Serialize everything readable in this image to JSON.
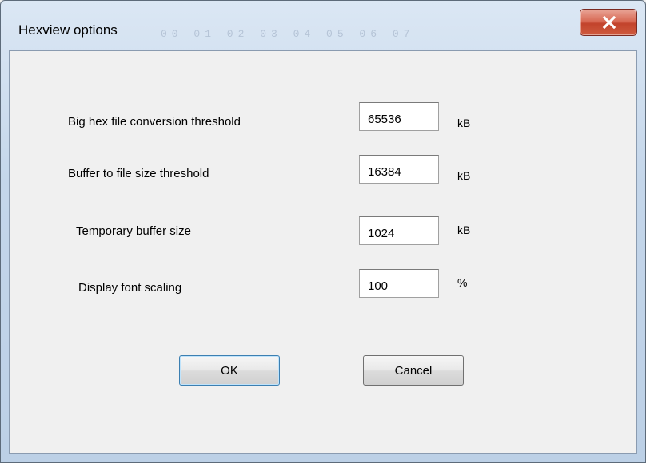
{
  "window": {
    "title": "Hexview options",
    "close_glyph": "x"
  },
  "background_ghost": "00 01 02 03   04 05 06 07",
  "fields": [
    {
      "label": "Big hex file conversion threshold",
      "value": "65536",
      "unit": "kB"
    },
    {
      "label": "Buffer to file size threshold",
      "value": "16384",
      "unit": "kB"
    },
    {
      "label": "Temporary buffer size",
      "value": "1024",
      "unit": "kB"
    },
    {
      "label": "Display font scaling",
      "value": "100",
      "unit": "%"
    }
  ],
  "buttons": {
    "ok_label": "OK",
    "cancel_label": "Cancel"
  },
  "colors": {
    "titlebar_glass": "#c4d6ea",
    "close_button": "#c2432c",
    "dialog_face": "#f0f0f0",
    "default_button_focus": "#3c7fb1"
  },
  "icons": {
    "close": "close-icon"
  }
}
